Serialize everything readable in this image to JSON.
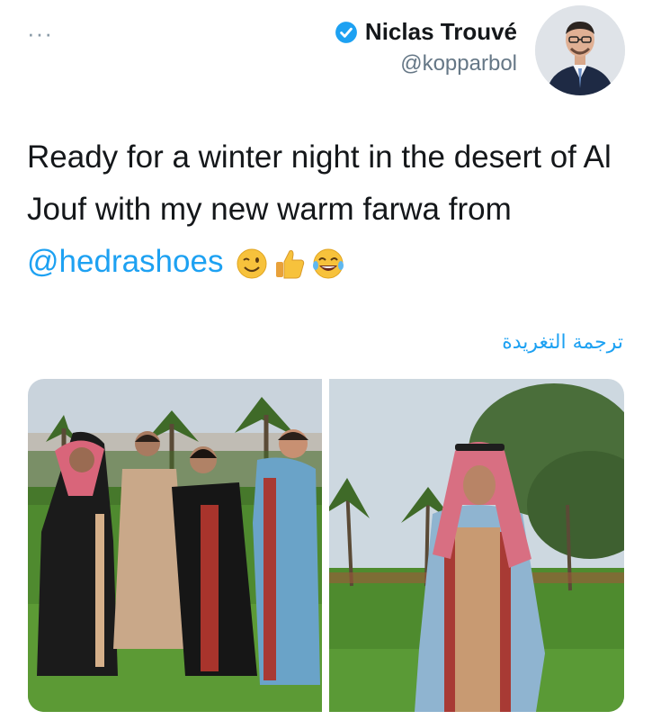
{
  "tweet": {
    "more_label": "···",
    "author": {
      "display_name": "Niclas Trouvé",
      "handle": "@kopparbol",
      "verified": true
    },
    "text_part1": "Ready for a winter night in the desert of Al Jouf with my new warm farwa from ",
    "mention": "@hedrashoes",
    "emojis": [
      "winking-face",
      "thumbs-up",
      "face-with-tears-of-joy"
    ],
    "translate_label": "ترجمة التغريدة",
    "photos": [
      {
        "description_icon": "group-photo-desert-palms"
      },
      {
        "description_icon": "man-in-farwa-by-trees"
      }
    ]
  },
  "colors": {
    "link": "#1da1f2",
    "secondary_text": "#657786",
    "primary_text": "#14171a"
  }
}
